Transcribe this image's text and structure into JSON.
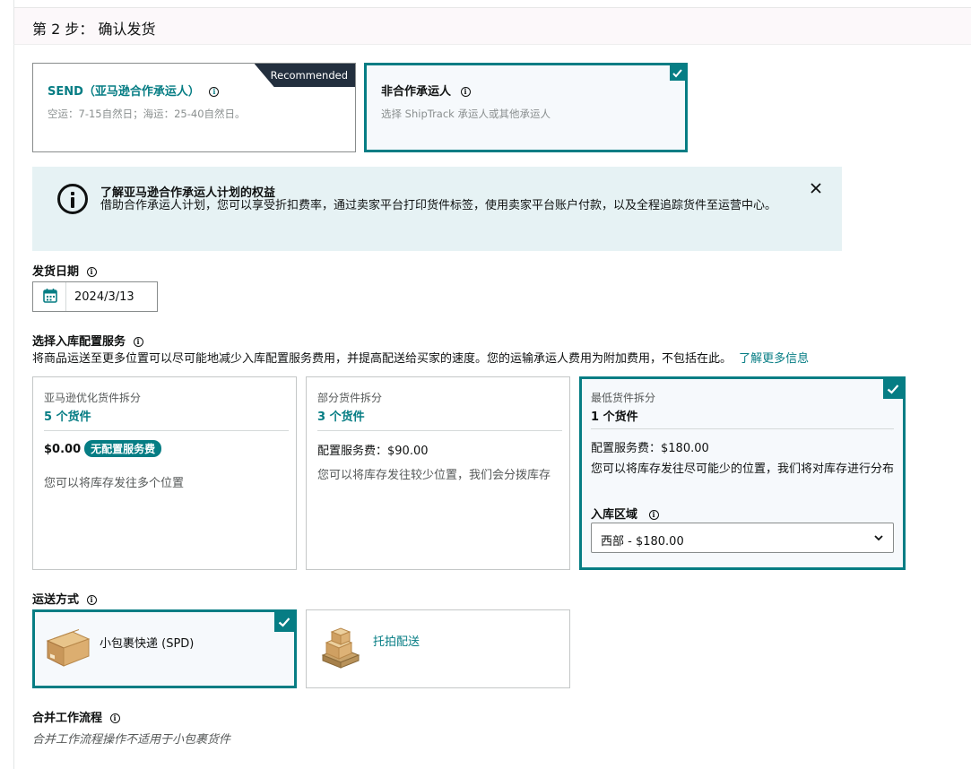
{
  "step": {
    "title": "第 2 步： 确认发货"
  },
  "carriers": [
    {
      "title": "SEND（亚马逊合作承运人）",
      "subtitle": "空运：7-15自然日；海运：25-40自然日。",
      "ribbon": "Recommended",
      "selected": false
    },
    {
      "title": "非合作承运人",
      "subtitle": "选择 ShipTrack 承运人或其他承运人",
      "selected": true
    }
  ],
  "alert": {
    "title": "了解亚马逊合作承运人计划的权益",
    "body": "借助合作承运人计划，您可以享受折扣费率，通过卖家平台打印货件标签，使用卖家平台账户付款，以及全程追踪货件至运营中心。"
  },
  "ship_date": {
    "label": "发货日期",
    "value": "2024/3/13"
  },
  "placement": {
    "label": "选择入库配置服务",
    "description": "将商品运送至更多位置可以尽可能地减少入库配置服务费用，并提高配送给买家的速度。您的运输承运人费用为附加费用，不包括在此。",
    "learn_more": "了解更多信息",
    "options": [
      {
        "name": "亚马逊优化货件拆分",
        "count": "5 个货件",
        "fee": "$0.00",
        "badge": "无配置服务费",
        "desc": "您可以将库存发往多个位置"
      },
      {
        "name": "部分货件拆分",
        "count": "3 个货件",
        "fee": "配置服务费：$90.00",
        "desc": "您可以将库存发往较少位置，我们会分拨库存"
      },
      {
        "name": "最低货件拆分",
        "count": "1 个货件",
        "fee": "配置服务费：$180.00",
        "desc": "您可以将库存发往尽可能少的位置，我们将对库存进行分布",
        "region_label": "入库区域",
        "region_value": "西部 - $180.00",
        "selected": true
      }
    ]
  },
  "shipping_mode": {
    "label": "运送方式",
    "options": [
      {
        "name": "小包裹快递 (SPD)",
        "icon": "box-icon",
        "selected": true
      },
      {
        "name": "托拍配送",
        "icon": "pallet-icon"
      }
    ]
  },
  "workflow": {
    "label": "合并工作流程",
    "note": "合并工作流程操作不适用于小包裹货件"
  },
  "colors": {
    "accent": "#067d84",
    "alert_bg": "#e6f2f4",
    "ribbon": "#232f3e"
  }
}
